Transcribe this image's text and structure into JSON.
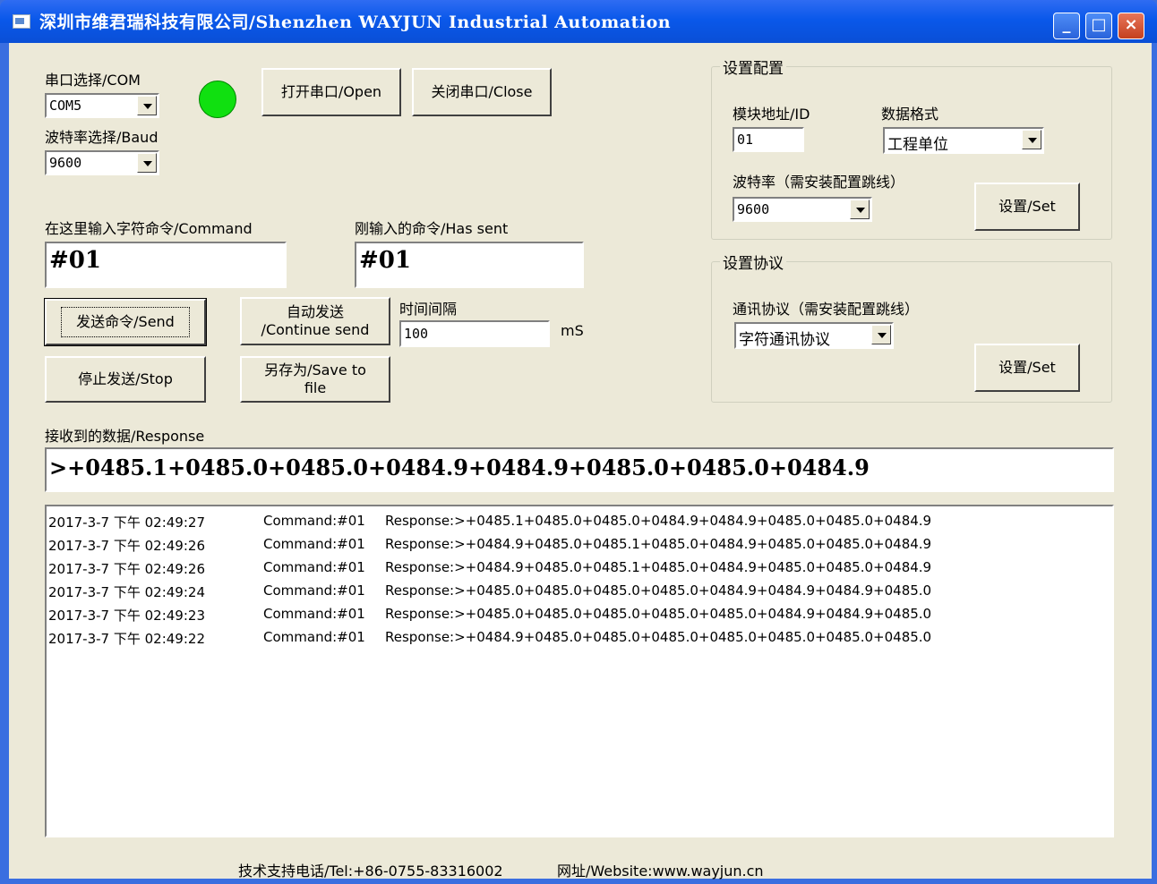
{
  "window": {
    "title": "深圳市维君瑞科技有限公司/Shenzhen WAYJUN Industrial Automation",
    "minimize": "_",
    "maximize": "□",
    "close": "×"
  },
  "serial": {
    "port_label": "串口选择/COM",
    "port_value": "COM5",
    "baud_label": "波特率选择/Baud",
    "baud_value": "9600",
    "open_button": "打开串口/Open",
    "close_button": "关闭串口/Close",
    "status_color": "#10e010"
  },
  "command": {
    "input_label": "在这里输入字符命令/Command",
    "input_value": "#01",
    "sent_label": "刚输入的命令/Has sent",
    "sent_value": "#01",
    "send_button": "发送命令/Send",
    "continue_button_line1": "自动发送",
    "continue_button_line2": "/Continue send",
    "interval_label": "时间间隔",
    "interval_value": "100",
    "interval_unit": "mS",
    "stop_button": "停止发送/Stop",
    "save_button_line1": "另存为/Save to",
    "save_button_line2": "file"
  },
  "config": {
    "title": "设置配置",
    "id_label": "模块地址/ID",
    "id_value": "01",
    "format_label": "数据格式",
    "format_value": "工程单位",
    "baud_label": "波特率（需安装配置跳线）",
    "baud_value": "9600",
    "set_button": "设置/Set"
  },
  "protocol": {
    "title": "设置协议",
    "label": "通讯协议（需安装配置跳线）",
    "value": "字符通讯协议",
    "set_button": "设置/Set"
  },
  "response": {
    "label": "接收到的数据/Response",
    "value": ">+0485.1+0485.0+0485.0+0484.9+0484.9+0485.0+0485.0+0484.9"
  },
  "log": [
    {
      "time": "2017-3-7 下午 02:49:27",
      "command": "Command:#01",
      "response": "Response:>+0485.1+0485.0+0485.0+0484.9+0484.9+0485.0+0485.0+0484.9"
    },
    {
      "time": "2017-3-7 下午 02:49:26",
      "command": "Command:#01",
      "response": "Response:>+0484.9+0485.0+0485.1+0485.0+0484.9+0485.0+0485.0+0484.9"
    },
    {
      "time": "2017-3-7 下午 02:49:26",
      "command": "Command:#01",
      "response": "Response:>+0484.9+0485.0+0485.1+0485.0+0484.9+0485.0+0485.0+0484.9"
    },
    {
      "time": "2017-3-7 下午 02:49:24",
      "command": "Command:#01",
      "response": "Response:>+0485.0+0485.0+0485.0+0485.0+0484.9+0484.9+0484.9+0485.0"
    },
    {
      "time": "2017-3-7 下午 02:49:23",
      "command": "Command:#01",
      "response": "Response:>+0485.0+0485.0+0485.0+0485.0+0485.0+0484.9+0484.9+0485.0"
    },
    {
      "time": "2017-3-7 下午 02:49:22",
      "command": "Command:#01",
      "response": "Response:>+0484.9+0485.0+0485.0+0485.0+0485.0+0485.0+0485.0+0485.0"
    }
  ],
  "footer": {
    "tel": "技术支持电话/Tel:+86-0755-83316002",
    "website": "网址/Website:www.wayjun.cn"
  }
}
